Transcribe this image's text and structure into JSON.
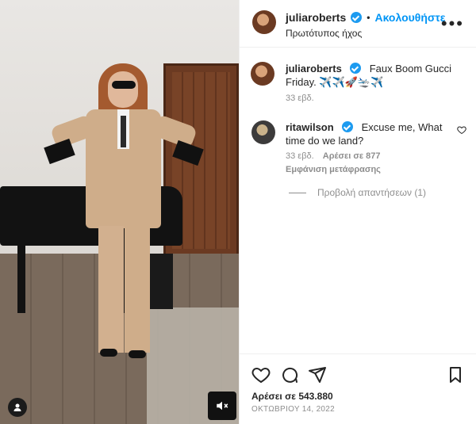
{
  "header": {
    "username": "juliaroberts",
    "separator": "•",
    "follow_label": "Ακολουθήστε",
    "audio_label": "Πρωτότυπος ήχος",
    "more_label": "•••"
  },
  "caption": {
    "username": "juliaroberts",
    "text": "Faux Boom Gucci Friday. ✈️✈️🚀🛬✈️",
    "time": "33 εβδ."
  },
  "comment": {
    "username": "ritawilson",
    "text": "Excuse me, What time do we land?",
    "time": "33 εβδ.",
    "likes": "Αρέσει σε 877",
    "translate": "Εμφάνιση μετάφρασης",
    "replies": "Προβολή απαντήσεων (1)"
  },
  "footer": {
    "likes": "Αρέσει σε 543.880",
    "date": "ΟΚΤΩΒΡΙΟΥ 14, 2022"
  },
  "colors": {
    "accent": "#0095f6",
    "verified": "#1d9bf0",
    "muted": "#8e8e8e",
    "text": "#262626"
  },
  "icons": {
    "like": "heart-icon",
    "comment": "comment-icon",
    "share": "share-icon",
    "save": "bookmark-icon",
    "mute": "mute-icon",
    "user": "user-icon"
  }
}
